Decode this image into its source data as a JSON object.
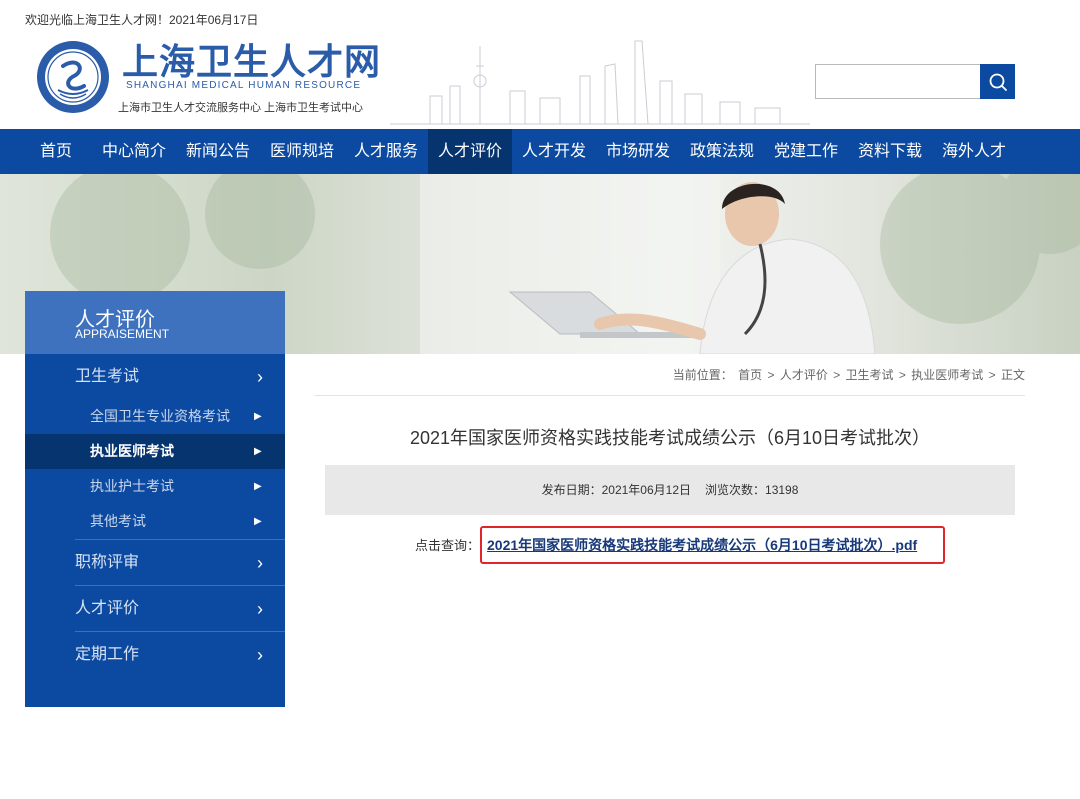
{
  "topbar": {
    "welcome": "欢迎光临上海卫生人才网！2021年06月17日"
  },
  "header": {
    "logo_title": "上海卫生人才网",
    "logo_en": "SHANGHAI MEDICAL HUMAN RESOURCE",
    "logo_sub": "上海市卫生人才交流服务中心  上海市卫生考试中心",
    "search": {
      "value": "",
      "placeholder": "",
      "icon": "search-icon"
    }
  },
  "nav": {
    "items": [
      "首页",
      "中心简介",
      "新闻公告",
      "医师规培",
      "人才服务",
      "人才评价",
      "人才开发",
      "市场研发",
      "政策法规",
      "党建工作",
      "资料下载",
      "海外人才"
    ],
    "active": "人才评价"
  },
  "sidebar": {
    "title": "人才评价",
    "title_en": "APPRAISEMENT",
    "sections": [
      {
        "label": "卫生考试",
        "expanded": true,
        "children": [
          "全国卫生专业资格考试",
          "执业医师考试",
          "执业护士考试",
          "其他考试"
        ]
      },
      {
        "label": "职称评审"
      },
      {
        "label": "人才评价"
      },
      {
        "label": "定期工作"
      }
    ],
    "active_child": "执业医师考试",
    "arrow": "›",
    "sub_arrow": "▶"
  },
  "breadcrumb": {
    "prefix": "当前位置：",
    "items": [
      "首页",
      "人才评价",
      "卫生考试",
      "执业医师考试",
      "正文"
    ],
    "separator": ">"
  },
  "article": {
    "title": "2021年国家医师资格实践技能考试成绩公示（6月10日考试批次）",
    "publish_label": "发布日期：",
    "publish_date": "2021年06月12日",
    "views_label": "浏览次数：",
    "views": "13198",
    "query_label": "点击查询：",
    "attachment": "2021年国家医师资格实践技能考试成绩公示（6月10日考试批次）.pdf"
  },
  "colors": {
    "primary": "#0b4aa0",
    "nav_active": "#06346f",
    "sidebar_header": "#3e72bf",
    "highlight_border": "#e0262b",
    "link": "#17397a"
  }
}
